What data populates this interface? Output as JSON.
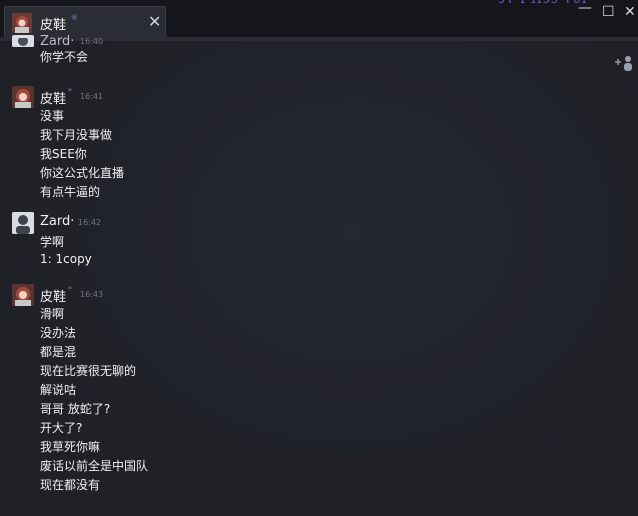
{
  "tab": {
    "name": "皮鞋",
    "star": "※",
    "close": "✕"
  },
  "window": {
    "watermark": "ɔʏ ɪ ɪɪɔs·ʏʋɪ",
    "minimize": "—",
    "maximize": "☐",
    "close": "✕"
  },
  "chat": {
    "top_partial": {
      "sender": "Zard·",
      "time": "16:40",
      "lines": [
        "你学不会"
      ]
    },
    "groups": [
      {
        "sender": "皮鞋",
        "star": "*",
        "time": "16:41",
        "lines": [
          "没事",
          "我下月没事做",
          "我SEE你",
          "你这公式化直播",
          "有点牛逼的"
        ]
      },
      {
        "sender": "Zard·",
        "star": "",
        "time": "16:42",
        "lines": [
          "学啊",
          "1: 1copy"
        ]
      },
      {
        "sender": "皮鞋",
        "star": "*",
        "time": "16:43",
        "lines": [
          "滑啊",
          "没办法",
          "都是混",
          "现在比赛很无聊的",
          "解说咕",
          "哥哥 放蛇了?",
          "开大了?",
          "我草死你嘛",
          "废话以前全是中国队",
          "现在都没有"
        ]
      }
    ]
  },
  "colors": {
    "background": "#1f2127",
    "titlebar": "#14161b",
    "text": "#f0f0f0",
    "time": "#6f7480"
  }
}
